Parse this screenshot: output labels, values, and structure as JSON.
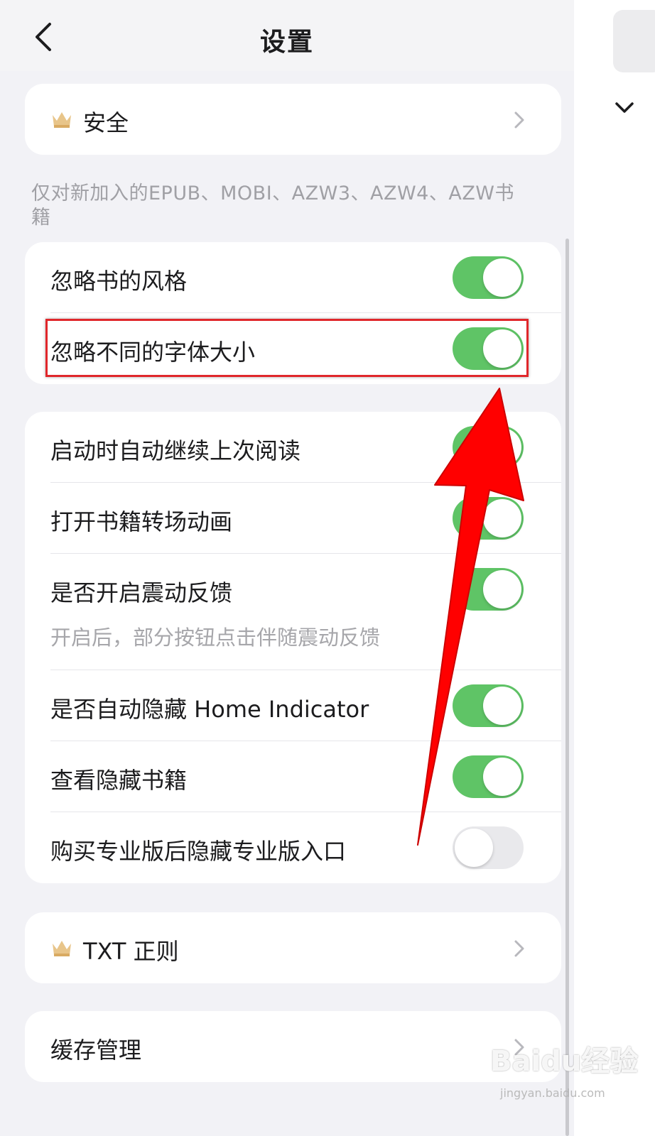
{
  "header": {
    "title": "设置"
  },
  "cards": {
    "security": {
      "label": "安全"
    },
    "note": "仅对新加入的EPUB、MOBI、AZW3、AZW4、AZW书籍",
    "book_style": [
      {
        "label": "忽略书的风格",
        "on": true
      },
      {
        "label": "忽略不同的字体大小",
        "on": true
      }
    ],
    "reading": [
      {
        "label": "启动时自动继续上次阅读",
        "on": true
      },
      {
        "label": "打开书籍转场动画",
        "on": true
      },
      {
        "label": "是否开启震动反馈",
        "sub": "开启后，部分按钮点击伴随震动反馈",
        "on": true
      },
      {
        "label": "是否自动隐藏 Home Indicator",
        "on": true
      },
      {
        "label": "查看隐藏书籍",
        "on": true
      },
      {
        "label": "购买专业版后隐藏专业版入口",
        "on": false
      }
    ],
    "txt_regex": {
      "label": "TXT 正则"
    },
    "cache": {
      "label": "缓存管理"
    }
  },
  "watermark": {
    "main": "Baidu经验",
    "sub": "jingyan.baidu.com"
  },
  "colors": {
    "toggle_on": "#5fc466",
    "toggle_off": "#e9e9ec",
    "highlight": "#e0272b",
    "arrow": "#ff0000"
  },
  "icons": {
    "back": "chevron-left-icon",
    "crown": "crown-icon",
    "chevron": "chevron-right-icon"
  }
}
